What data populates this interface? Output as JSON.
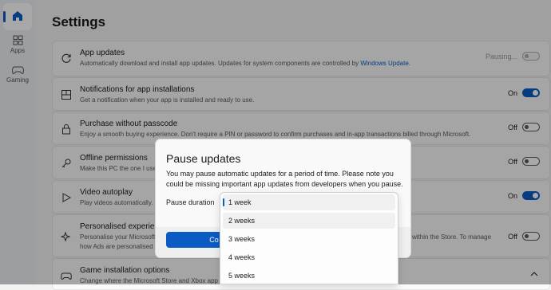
{
  "nav": {
    "apps_label": "Apps",
    "gaming_label": "Gaming"
  },
  "page": {
    "title": "Settings"
  },
  "settings": [
    {
      "title": "App updates",
      "description_prefix": "Automatically download and install app updates. Updates for system components are controlled by ",
      "description_link": "Windows Update",
      "description_suffix": ".",
      "state": "Pausing...",
      "toggle": "disabled"
    },
    {
      "title": "Notifications for app installations",
      "description": "Get a notification when your app is installed and ready to use.",
      "state": "On",
      "toggle": "on"
    },
    {
      "title": "Purchase without passcode",
      "description": "Enjoy a smooth buying experience. Don't require a PIN or password to confirm purchases and in-app transactions billed through Microsoft.",
      "state": "Off",
      "toggle": "off"
    },
    {
      "title": "Offline permissions",
      "description": "Make this PC the one I use",
      "state": "Off",
      "toggle": "off"
    },
    {
      "title": "Video autoplay",
      "description": "Play videos automatically.",
      "state": "On",
      "toggle": "on"
    },
    {
      "title": "Personalised experience",
      "description": "Personalise your Microsoft",
      "description2": "how Ads are personalised f",
      "description_right": "within the Store. To manage",
      "state": "Off",
      "toggle": "off"
    },
    {
      "title": "Game installation options",
      "description": "Change where the Microsoft Store and Xbox app i"
    }
  ],
  "dialog": {
    "title": "Pause updates",
    "message": "You may pause automatic updates for a period of time. Please note you could be missing important app updates from developers when you pause.",
    "duration_label": "Pause duration",
    "confirm_label": "Co",
    "options": [
      "1 week",
      "2 weeks",
      "3 weeks",
      "4 weeks",
      "5 weeks"
    ],
    "selected_option": "1 week"
  },
  "colors": {
    "accent": "#0a5bc4",
    "background": "#f3f3f3"
  }
}
